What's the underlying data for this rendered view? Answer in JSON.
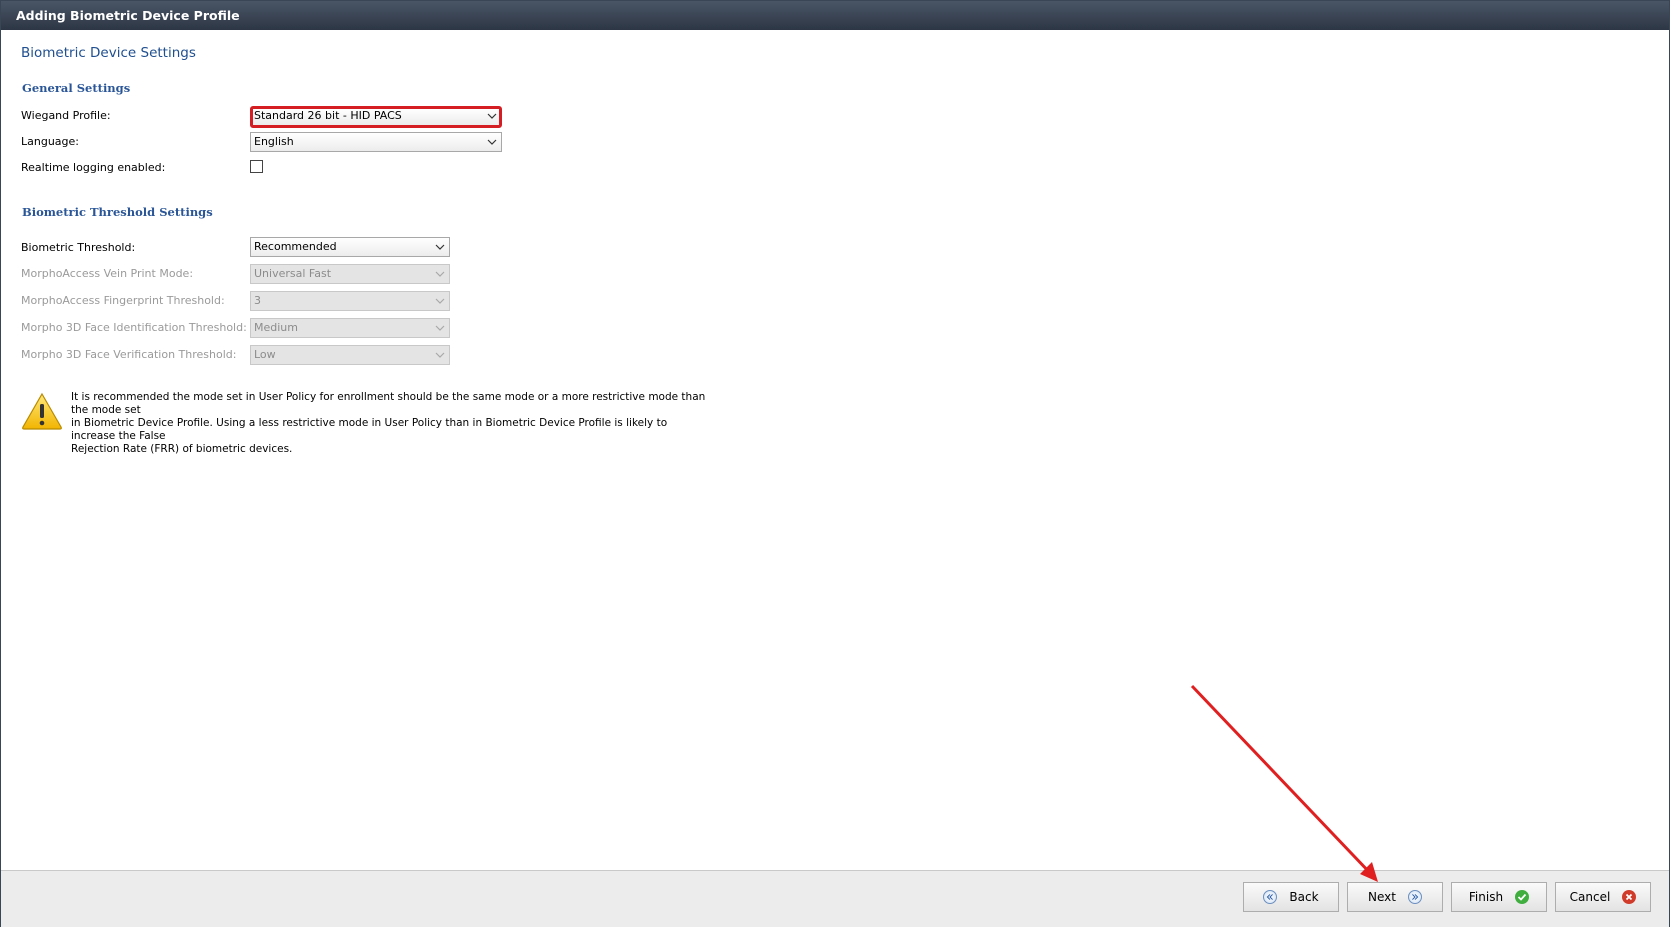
{
  "window": {
    "title": "Adding Biometric Device Profile"
  },
  "page": {
    "title": "Biometric Device Settings"
  },
  "general": {
    "heading": "General Settings",
    "wiegand_label": "Wiegand Profile:",
    "wiegand_value": "Standard 26 bit - HID PACS",
    "language_label": "Language:",
    "language_value": "English",
    "realtime_label": "Realtime logging enabled:",
    "realtime_checked": false
  },
  "threshold": {
    "heading": "Biometric Threshold Settings",
    "biometric_label": "Biometric Threshold:",
    "biometric_value": "Recommended",
    "vein_label": "MorphoAccess Vein Print Mode:",
    "vein_value": "Universal Fast",
    "fingerprint_label": "MorphoAccess Fingerprint Threshold:",
    "fingerprint_value": "3",
    "face_ident_label": "Morpho 3D Face Identification Threshold:",
    "face_ident_value": "Medium",
    "face_verif_label": "Morpho 3D Face Verification Threshold:",
    "face_verif_value": "Low"
  },
  "warning": {
    "icon": "warning-icon",
    "line1": "It is recommended the mode set in User Policy for enrollment should be the same mode or a more restrictive mode than the mode set",
    "line2": "in Biometric Device Profile.  Using a less restrictive mode in User Policy than in Biometric Device Profile is likely to increase the False",
    "line3": "Rejection Rate (FRR) of biometric devices."
  },
  "footer": {
    "back_label": "Back",
    "next_label": "Next",
    "finish_label": "Finish",
    "cancel_label": "Cancel"
  },
  "colors": {
    "highlight": "#d41e24",
    "heading": "#2a5698",
    "annotation_arrow": "#e02020"
  }
}
